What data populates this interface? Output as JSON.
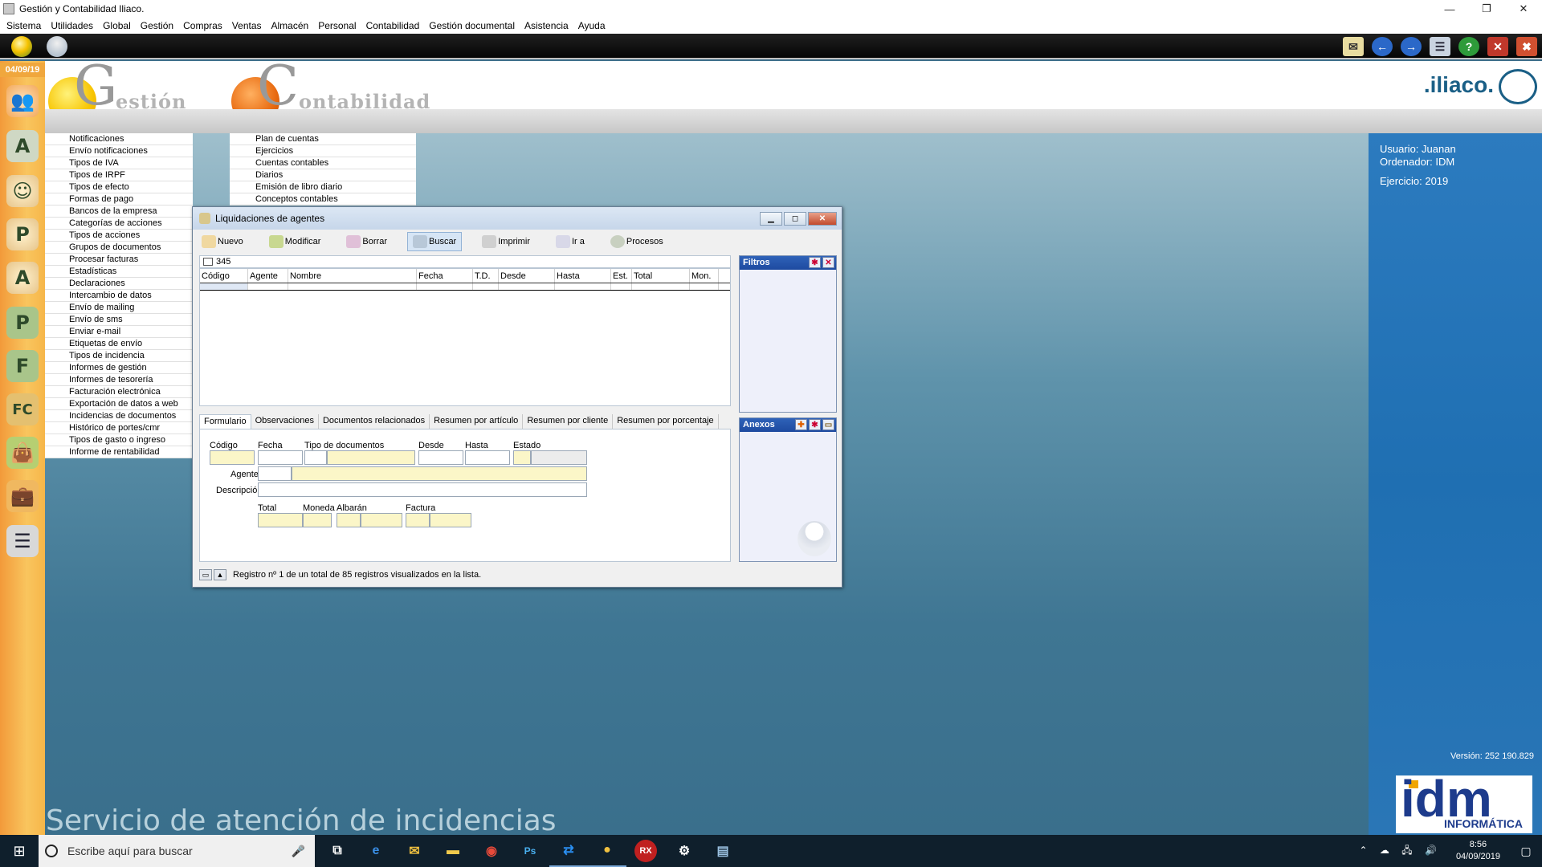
{
  "window": {
    "title": "Gestión y Contabilidad Iliaco."
  },
  "menubar": [
    "Sistema",
    "Utilidades",
    "Global",
    "Gestión",
    "Compras",
    "Ventas",
    "Almacén",
    "Personal",
    "Contabilidad",
    "Gestión documental",
    "Asistencia",
    "Ayuda"
  ],
  "leftbar": {
    "date": "04/09/19"
  },
  "header": {
    "logo_gestion_initial": "G",
    "logo_gestion_word": "estión",
    "logo_contabilidad_initial": "C",
    "logo_contabilidad_word": "ontabilidad",
    "brand": ".iliaco."
  },
  "menu1": [
    "Notificaciones",
    "Envío notificaciones",
    "Tipos de IVA",
    "Tipos de IRPF",
    "Tipos de efecto",
    "Formas de pago",
    "Bancos de la empresa",
    "Categorías de acciones",
    "Tipos de acciones",
    "Grupos de documentos",
    "Procesar facturas",
    "Estadísticas",
    "Declaraciones",
    "Intercambio de datos",
    "Envío de mailing",
    "Envío de sms",
    "Enviar e-mail",
    "Etiquetas de envío",
    "Tipos de incidencia",
    "Informes de gestión",
    "Informes de tesorería",
    "Facturación electrónica",
    "Exportación de datos a web",
    "Incidencias de documentos",
    "Histórico de portes/cmr",
    "Tipos de gasto o ingreso",
    "Informe de rentabilidad"
  ],
  "menu2": [
    "Plan de cuentas",
    "Ejercicios",
    "Cuentas contables",
    "Diarios",
    "Emisión de libro diario",
    "Conceptos contables"
  ],
  "service_text": "Servicio de atención de incidencias",
  "info": {
    "usuario": "Usuario: Juanan",
    "ordenador": "Ordenador: IDM",
    "ejercicio": "Ejercicio: 2019",
    "version": "Versión: 252 190.829",
    "idm": "idm",
    "idm_sub": "INFORMÁTICA"
  },
  "dialog": {
    "title": "Liquidaciones de agentes",
    "toolbar": {
      "nuevo": "Nuevo",
      "modificar": "Modificar",
      "borrar": "Borrar",
      "buscar": "Buscar",
      "imprimir": "Imprimir",
      "ir_a": "Ir a",
      "procesos": "Procesos"
    },
    "search_value": "345",
    "columns": [
      "Código",
      "Agente",
      "Nombre",
      "Fecha",
      "T.D.",
      "Desde",
      "Hasta",
      "Est.",
      "Total",
      "Mon."
    ],
    "filtros_title": "Filtros",
    "anexos_title": "Anexos",
    "tabs": [
      "Formulario",
      "Observaciones",
      "Documentos relacionados",
      "Resumen por artículo",
      "Resumen por cliente",
      "Resumen por porcentaje"
    ],
    "form": {
      "codigo": "Código",
      "fecha": "Fecha",
      "tipo_documentos": "Tipo de documentos",
      "desde": "Desde",
      "hasta": "Hasta",
      "estado": "Estado",
      "agente": "Agente",
      "descripcion": "Descripción",
      "total": "Total",
      "moneda": "Moneda",
      "albaran": "Albarán",
      "factura": "Factura"
    },
    "status": "Registro nº 1 de un total de 85 registros visualizados en la lista."
  },
  "taskbar": {
    "search_placeholder": "Escribe aquí para buscar",
    "time": "8:56",
    "date": "04/09/2019"
  },
  "colors": {
    "accent_orange": "#f29a3a",
    "info_blue": "#1f6fb2",
    "panel_head": "#1e4aa0"
  }
}
